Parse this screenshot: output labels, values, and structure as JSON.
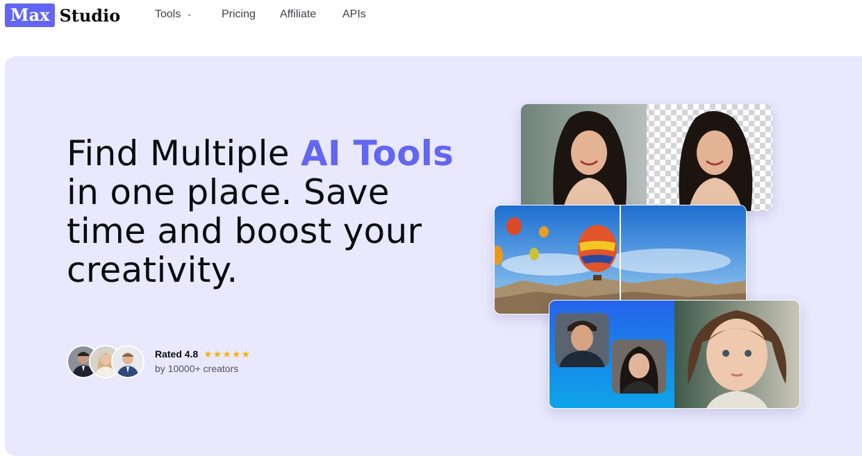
{
  "nav": {
    "logo_max": "Max",
    "logo_studio": "Studio",
    "items": [
      {
        "label": "Tools",
        "has_dropdown": true
      },
      {
        "label": "Pricing"
      },
      {
        "label": "Affiliate"
      },
      {
        "label": "APIs"
      }
    ]
  },
  "hero": {
    "headline_part1": "Find Multiple ",
    "headline_accent": "AI Tools",
    "headline_part2": " in one place. Save time and boost your creativity.",
    "rating_label": "Rated 4.8",
    "rating_value": 4.8,
    "stars": "★★★★★",
    "rating_caption": "by 10000+ creators"
  },
  "colors": {
    "accent": "#6366f1",
    "hero_bg": "#e9e8fd",
    "star": "#f5b301"
  }
}
